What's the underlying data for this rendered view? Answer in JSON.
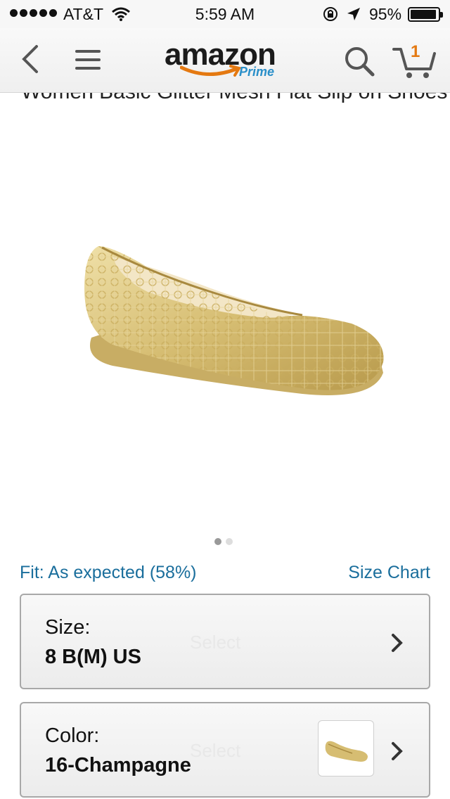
{
  "status_bar": {
    "carrier": "AT&T",
    "time": "5:59 AM",
    "battery": "95%",
    "battery_level": 0.95,
    "icons": [
      "signal-dots-icon",
      "wifi-icon",
      "rotation-lock-icon",
      "location-arrow-icon",
      "battery-icon"
    ]
  },
  "nav": {
    "logo_word": "amazon",
    "logo_prime": "Prime",
    "cart_count": "1",
    "icons": [
      "back-chevron-icon",
      "hamburger-menu-icon",
      "search-icon",
      "cart-icon"
    ]
  },
  "product": {
    "title_partial": "Women Basic Glitter Mesh Flat Slip on Shoes",
    "image_icon": "gold-ballet-flat-image",
    "carousel": {
      "count": 2,
      "active": 0
    }
  },
  "fit": {
    "text": "Fit: As expected (58%)",
    "size_chart_link": "Size Chart"
  },
  "size_selector": {
    "label": "Size:",
    "value": "8 B(M) US",
    "ghost_text": "Select"
  },
  "color_selector": {
    "label": "Color:",
    "value": "16-Champagne",
    "ghost_text": "Select"
  },
  "colors": {
    "link": "#1a6e9c",
    "amazon_orange": "#e47911",
    "prime_blue": "#2a8fc9",
    "shoe_gold": "#d9c27e"
  }
}
